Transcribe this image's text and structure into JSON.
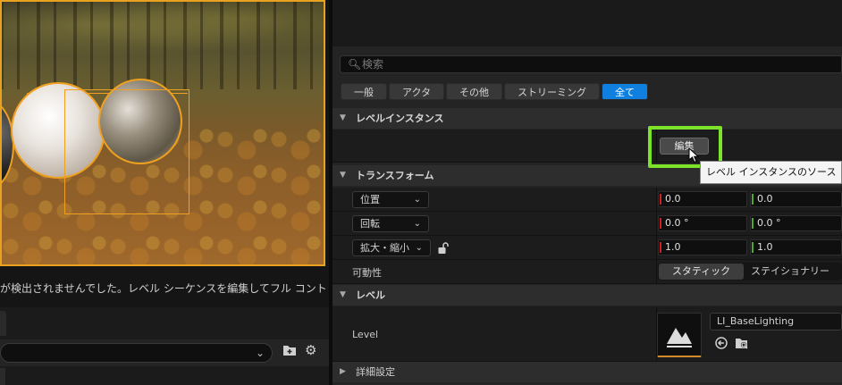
{
  "viewport": {
    "status_message": "が検出されませんでした。レベル シーケンスを編集してフル コント"
  },
  "outliner": {
    "dropdown_value": ""
  },
  "details": {
    "search_placeholder": "検索",
    "filters": [
      {
        "label": "一般",
        "active": false
      },
      {
        "label": "アクタ",
        "active": false
      },
      {
        "label": "その他",
        "active": false
      },
      {
        "label": "ストリーミング",
        "active": false
      },
      {
        "label": "全て",
        "active": true
      }
    ],
    "level_instance_section": {
      "title": "レベルインスタンス",
      "edit_button": "編集",
      "tooltip": "レベル インスタンスのソース"
    },
    "transform_section": {
      "title": "トランスフォーム",
      "location": {
        "label": "位置",
        "x": "0.0",
        "y": "0.0"
      },
      "rotation": {
        "label": "回転",
        "x": "0.0 °",
        "y": "0.0 °"
      },
      "scale": {
        "label": "拡大・縮小",
        "x": "1.0",
        "y": "1.0"
      },
      "mobility": {
        "label": "可動性",
        "options": [
          "スタティック",
          "ステイショナリー"
        ],
        "selected": "スタティック"
      }
    },
    "level_section": {
      "title": "レベル",
      "property_label": "Level",
      "asset_name": "LI_BaseLighting"
    },
    "advanced_section": {
      "title": "詳細設定"
    }
  },
  "colors": {
    "accent_blue": "#0f7fe0",
    "highlight_green": "#7de22a",
    "selection_orange": "#f0a020",
    "axis_x": "#d02020",
    "axis_y": "#4ca829"
  }
}
